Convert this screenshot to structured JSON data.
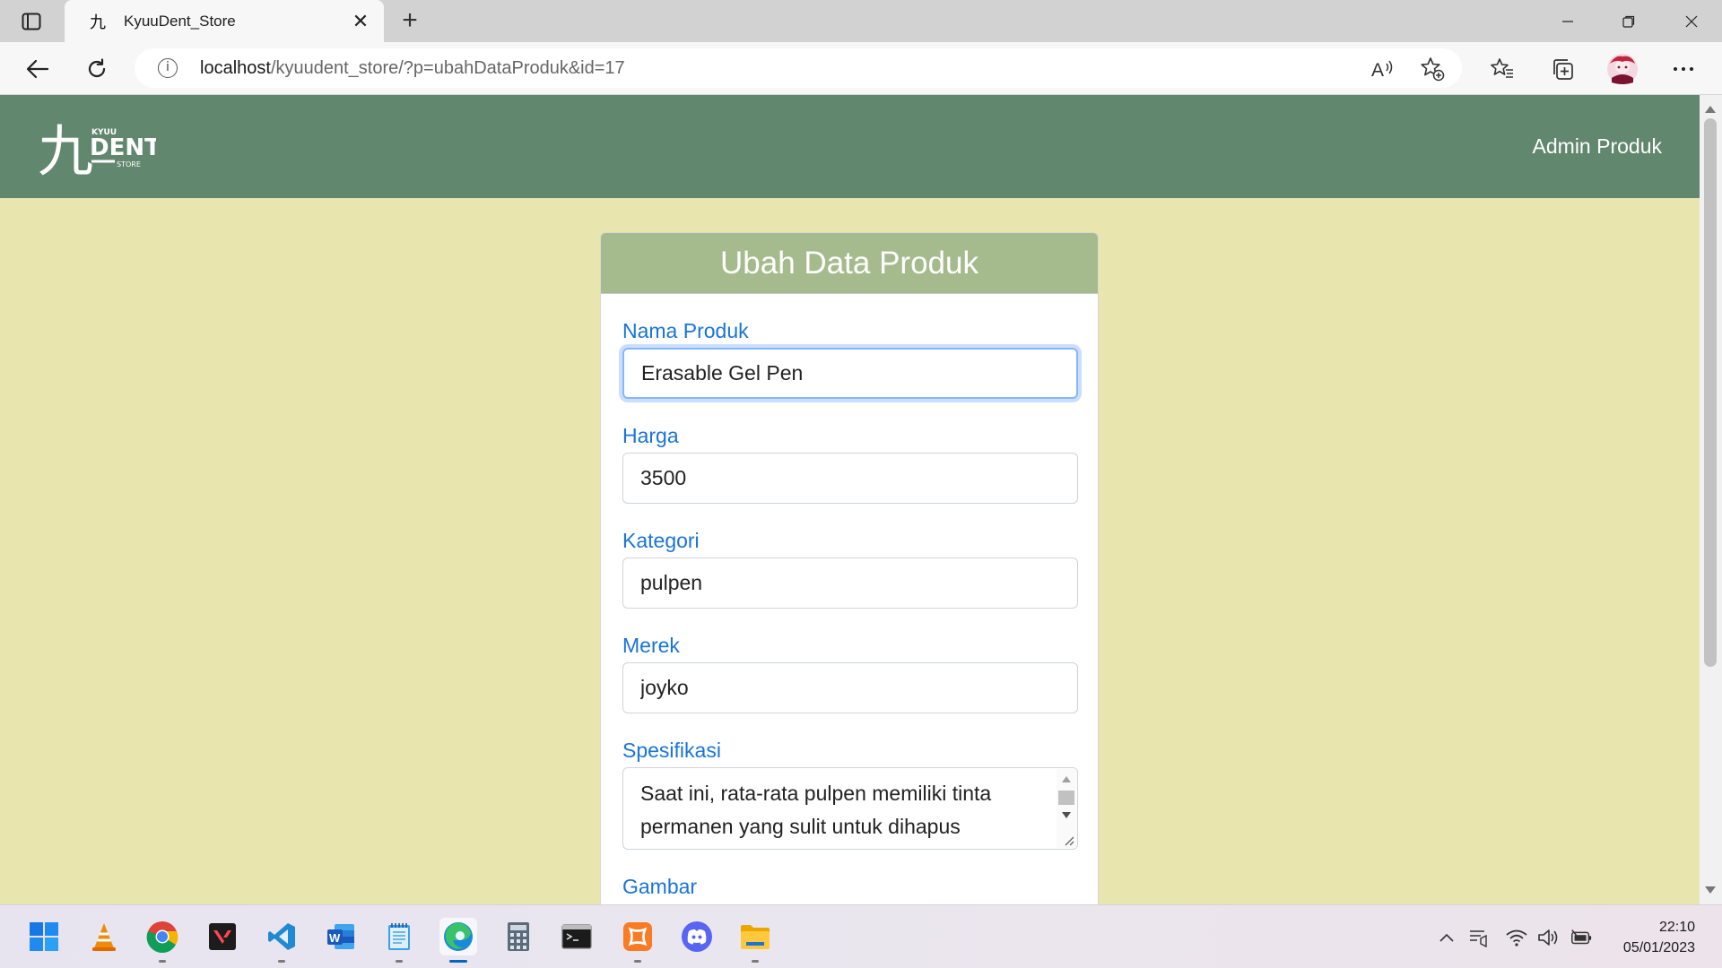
{
  "browser": {
    "tab_title": "KyuuDent_Store",
    "favicon_glyph": "九",
    "url_host": "localhost",
    "url_path": "/kyuudent_store/?p=ubahDataProduk&id=17",
    "read_aloud_glyph": "A"
  },
  "navbar": {
    "logo": {
      "glyph": "九",
      "small_top": "KYUU",
      "big": "DENT",
      "small_bottom": "STORE"
    },
    "link": "Admin Produk"
  },
  "form": {
    "title": "Ubah Data Produk",
    "fields": {
      "nama": {
        "label": "Nama Produk",
        "value": "Erasable Gel Pen"
      },
      "harga": {
        "label": "Harga",
        "value": "3500"
      },
      "kategori": {
        "label": "Kategori",
        "value": "pulpen"
      },
      "merek": {
        "label": "Merek",
        "value": "joyko"
      },
      "spesifikasi": {
        "label": "Spesifikasi",
        "value": "Saat ini, rata-rata pulpen memiliki tinta permanen yang sulit untuk dihapus"
      },
      "gambar": {
        "label": "Gambar"
      }
    }
  },
  "taskbar": {
    "apps": [
      "start",
      "vlc",
      "chrome",
      "valorant",
      "vscode",
      "word",
      "notepad",
      "edge",
      "calculator",
      "terminal",
      "xampp",
      "discord",
      "file-explorer"
    ],
    "time": "22:10",
    "date": "05/01/2023"
  },
  "colors": {
    "navbar": "#61876e",
    "card_header": "#a6bb8d",
    "page_bg": "#e8e5af",
    "label": "#1874d9"
  }
}
